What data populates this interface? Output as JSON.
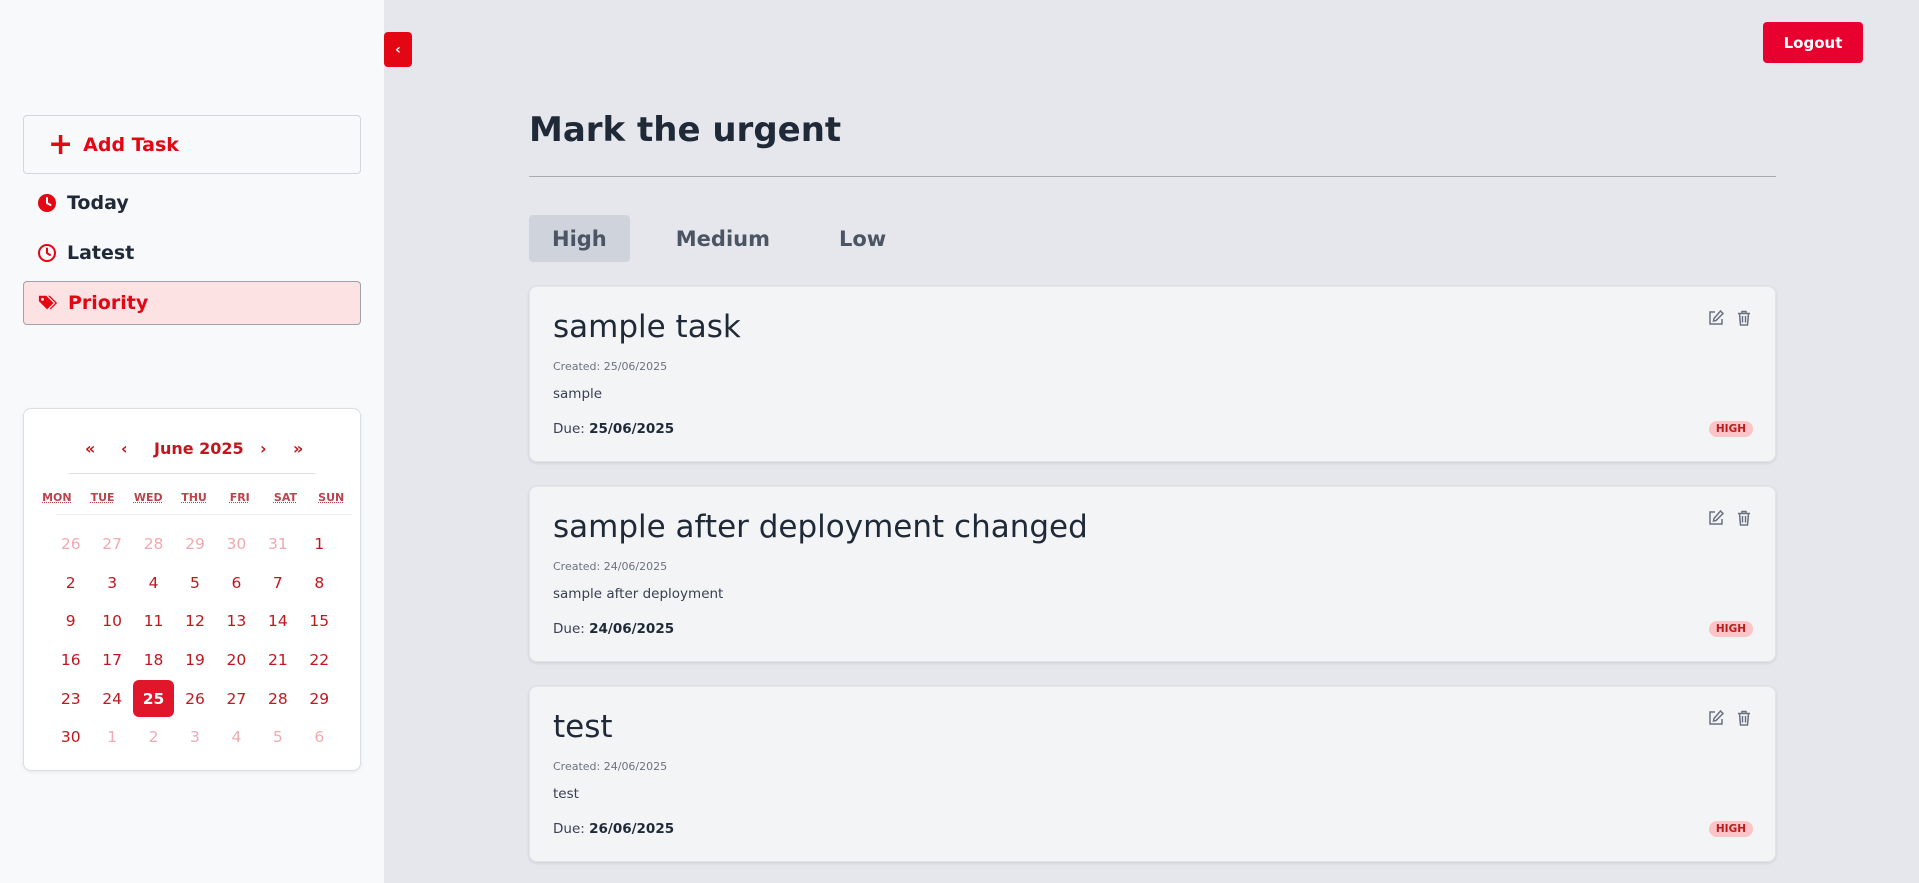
{
  "sidebar": {
    "add_task_label": "Add Task",
    "nav": [
      {
        "label": "Today",
        "icon": "clock-solid-icon"
      },
      {
        "label": "Latest",
        "icon": "clock-outline-icon"
      },
      {
        "label": "Priority",
        "icon": "tags-icon",
        "active": true
      }
    ]
  },
  "calendar": {
    "prev_year": "«",
    "prev_month": "‹",
    "month_label": "June 2025",
    "next_month": "›",
    "next_year": "»",
    "weekdays": [
      "MON",
      "TUE",
      "WED",
      "THU",
      "FRI",
      "SAT",
      "SUN"
    ],
    "days": [
      {
        "d": "26",
        "other": true
      },
      {
        "d": "27",
        "other": true
      },
      {
        "d": "28",
        "other": true
      },
      {
        "d": "29",
        "other": true
      },
      {
        "d": "30",
        "other": true
      },
      {
        "d": "31",
        "other": true
      },
      {
        "d": "1"
      },
      {
        "d": "2"
      },
      {
        "d": "3"
      },
      {
        "d": "4"
      },
      {
        "d": "5"
      },
      {
        "d": "6"
      },
      {
        "d": "7"
      },
      {
        "d": "8"
      },
      {
        "d": "9"
      },
      {
        "d": "10"
      },
      {
        "d": "11"
      },
      {
        "d": "12"
      },
      {
        "d": "13"
      },
      {
        "d": "14"
      },
      {
        "d": "15"
      },
      {
        "d": "16"
      },
      {
        "d": "17"
      },
      {
        "d": "18"
      },
      {
        "d": "19"
      },
      {
        "d": "20"
      },
      {
        "d": "21"
      },
      {
        "d": "22"
      },
      {
        "d": "23"
      },
      {
        "d": "24"
      },
      {
        "d": "25",
        "active": true
      },
      {
        "d": "26"
      },
      {
        "d": "27"
      },
      {
        "d": "28"
      },
      {
        "d": "29"
      },
      {
        "d": "30"
      },
      {
        "d": "1",
        "other": true
      },
      {
        "d": "2",
        "other": true
      },
      {
        "d": "3",
        "other": true
      },
      {
        "d": "4",
        "other": true
      },
      {
        "d": "5",
        "other": true
      },
      {
        "d": "6",
        "other": true
      }
    ]
  },
  "toggle_label": "‹",
  "header": {
    "logout_label": "Logout"
  },
  "main": {
    "title": "Mark the urgent",
    "tabs": [
      {
        "label": "High",
        "active": true
      },
      {
        "label": "Medium"
      },
      {
        "label": "Low"
      }
    ],
    "due_prefix": "Due: ",
    "tasks": [
      {
        "title": "sample task",
        "created": "Created: 25/06/2025",
        "description": "sample",
        "due": "25/06/2025",
        "priority": "HIGH"
      },
      {
        "title": "sample after deployment changed",
        "created": "Created: 24/06/2025",
        "description": "sample after deployment",
        "due": "24/06/2025",
        "priority": "HIGH"
      },
      {
        "title": "test",
        "created": "Created: 24/06/2025",
        "description": "test",
        "due": "26/06/2025",
        "priority": "HIGH"
      }
    ]
  },
  "colors": {
    "accent": "#e30613",
    "page_bg": "#e6e7ec",
    "sidebar_bg": "#f8f9fb"
  }
}
